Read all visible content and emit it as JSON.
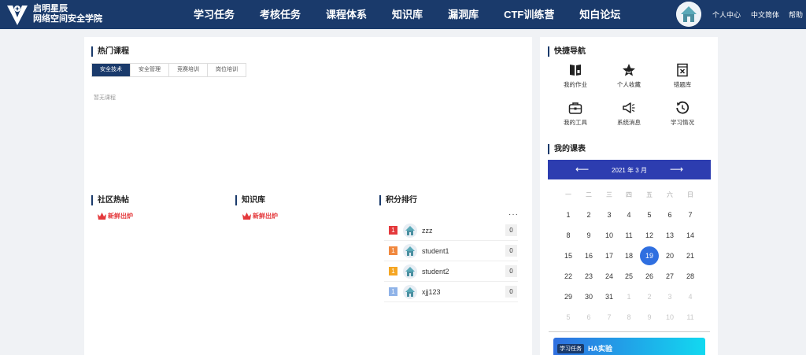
{
  "header": {
    "brand_line1": "启明星辰",
    "brand_line2": "网络空间安全学院",
    "nav": [
      {
        "label": "学习任务"
      },
      {
        "label": "考核任务"
      },
      {
        "label": "课程体系"
      },
      {
        "label": "知识库"
      },
      {
        "label": "漏洞库"
      },
      {
        "label": "CTF训练营"
      },
      {
        "label": "知白论坛"
      }
    ],
    "personal_center": "个人中心",
    "language": "中文简体",
    "help": "帮助"
  },
  "hot_courses": {
    "title": "热门课程",
    "tabs": [
      "安全技术",
      "安全管理",
      "竞赛培训",
      "岗位培训"
    ],
    "active_tab": 0,
    "empty_text": "暂无课程"
  },
  "community": {
    "title": "社区热帖",
    "fresh_label": "新鲜出炉"
  },
  "knowledge": {
    "title": "知识库",
    "fresh_label": "新鲜出炉"
  },
  "ranking": {
    "title": "积分排行",
    "more": "···",
    "rows": [
      {
        "rank": "1",
        "name": "zzz",
        "score": "0",
        "color": "#e4393c"
      },
      {
        "rank": "1",
        "name": "student1",
        "score": "0",
        "color": "#f0883e"
      },
      {
        "rank": "1",
        "name": "student2",
        "score": "0",
        "color": "#f5a623"
      },
      {
        "rank": "1",
        "name": "xjj123",
        "score": "0",
        "color": "#8fb3e8"
      }
    ]
  },
  "quick_nav": {
    "title": "快捷导航",
    "items": [
      {
        "label": "我的作业",
        "icon": "homework-icon"
      },
      {
        "label": "个人收藏",
        "icon": "star-icon"
      },
      {
        "label": "错题库",
        "icon": "wrong-questions-icon"
      },
      {
        "label": "我的工具",
        "icon": "toolbox-icon"
      },
      {
        "label": "系统消息",
        "icon": "megaphone-icon"
      },
      {
        "label": "学习情况",
        "icon": "history-icon"
      }
    ]
  },
  "calendar": {
    "title": "我的课表",
    "month_label": "2021 年 3 月",
    "prev": "⟵",
    "next": "⟶",
    "weekdays": [
      "一",
      "二",
      "三",
      "四",
      "五",
      "六",
      "日"
    ],
    "weeks": [
      [
        "1",
        "2",
        "3",
        "4",
        "5",
        "6",
        "7"
      ],
      [
        "8",
        "9",
        "10",
        "11",
        "12",
        "13",
        "14"
      ],
      [
        "15",
        "16",
        "17",
        "18",
        "19",
        "20",
        "21"
      ],
      [
        "22",
        "23",
        "24",
        "25",
        "26",
        "27",
        "28"
      ],
      [
        "29",
        "30",
        "31",
        "1",
        "2",
        "3",
        "4"
      ],
      [
        "5",
        "6",
        "7",
        "8",
        "9",
        "10",
        "11"
      ]
    ],
    "today": "19",
    "today_color": "#2f6fe0",
    "header_color": "#2d3db0"
  },
  "task_card": {
    "tag": "学习任务",
    "name": "HA实验"
  },
  "colors": {
    "header_bg": "#1a3a6b",
    "hot_red": "#e4393c"
  }
}
